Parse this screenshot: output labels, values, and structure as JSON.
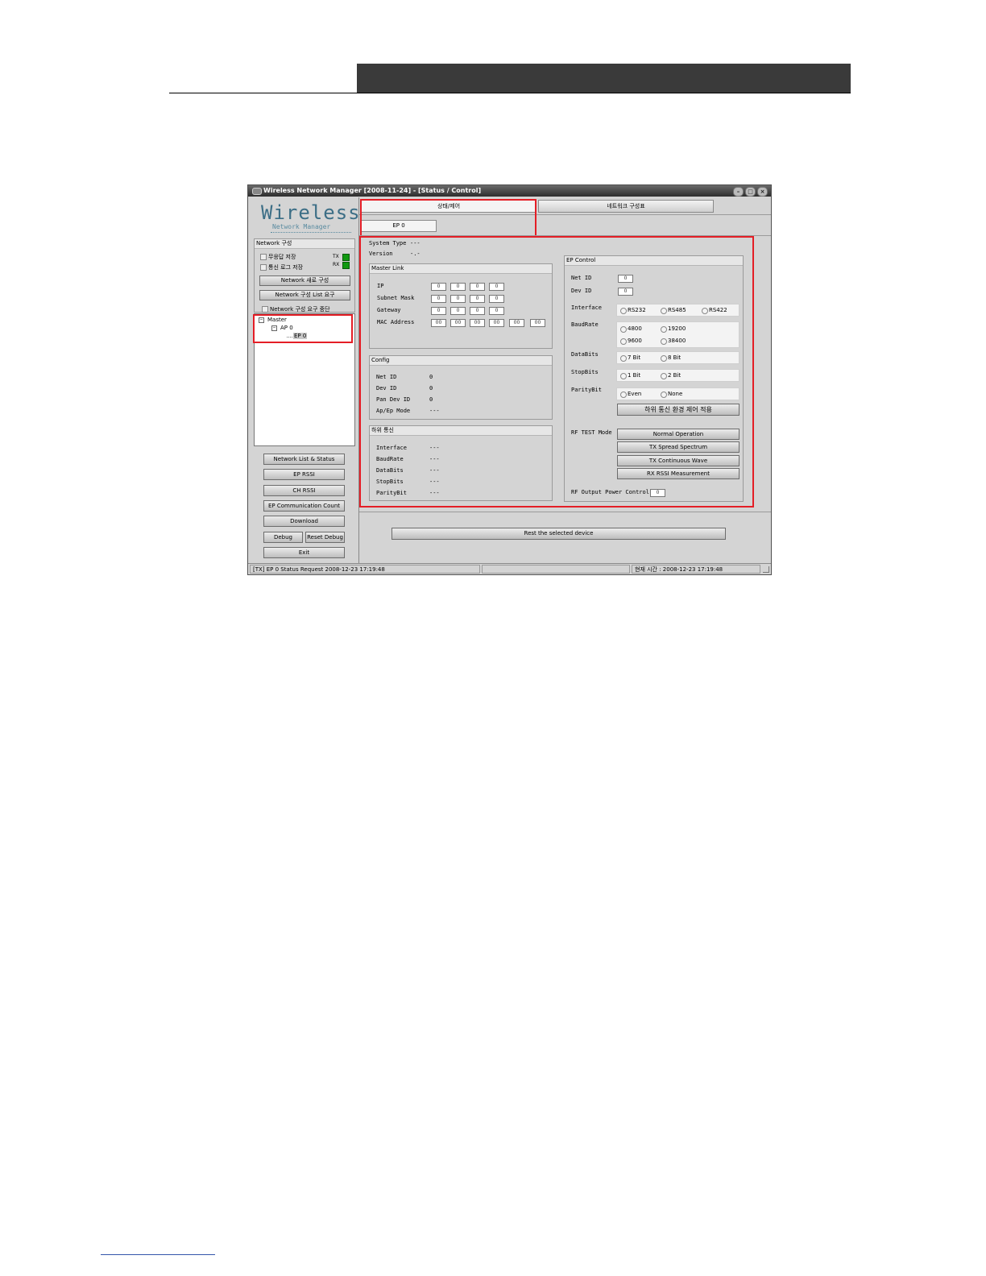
{
  "window": {
    "title": "Wireless Network Manager [2008-11-24] - [Status / Control]",
    "min": "–",
    "max": "□",
    "close": "×"
  },
  "logo": {
    "title": "Wireless",
    "subtitle": "Network Manager"
  },
  "network_group": {
    "title": "Network 구성",
    "chk_no_response_save": "무응답 저장",
    "chk_comm_log_save": "통신 로그 저장",
    "tx_label": "TX",
    "rx_label": "RX",
    "btn_new_config": "Network 새로 구성",
    "btn_config_list_request": "Network 구성 List 요구",
    "chk_config_request_stop": "Network 구성 요구 중단"
  },
  "tree": {
    "master": "Master",
    "ap": "AP 0",
    "ep": "EP 0"
  },
  "left_buttons": {
    "network_list_status": "Network List & Status",
    "ep_rssi": "EP RSSI",
    "ch_rssi": "CH RSSI",
    "ep_comm_count": "EP Communication Count",
    "download": "Download",
    "debug": "Debug",
    "reset_debug": "Reset Debug",
    "exit": "Exit"
  },
  "tabs": {
    "status_control": "상태/제어",
    "network_config": "네트워크 구성표",
    "ep0": "EP 0"
  },
  "system": {
    "type_label": "System Type",
    "type_value": "---",
    "version_label": "Version",
    "version_value": "-.-"
  },
  "master_link": {
    "title": "Master Link",
    "ip_label": "IP",
    "subnet_label": "Subnet Mask",
    "gateway_label": "Gateway",
    "mac_label": "MAC Address",
    "ip": [
      "0",
      "0",
      "0",
      "0"
    ],
    "subnet": [
      "0",
      "0",
      "0",
      "0"
    ],
    "gateway": [
      "0",
      "0",
      "0",
      "0"
    ],
    "mac": [
      "00",
      "00",
      "00",
      "00",
      "00",
      "00"
    ]
  },
  "config": {
    "title": "Config",
    "net_id_label": "Net ID",
    "net_id": "0",
    "dev_id_label": "Dev ID",
    "dev_id": "0",
    "pan_dev_id_label": "Pan Dev ID",
    "pan_dev_id": "0",
    "mode_label": "Ap/Ep Mode",
    "mode": "---"
  },
  "lower_comm": {
    "title": "하위 통신",
    "interface_label": "Interface",
    "interface": "---",
    "baudrate_label": "BaudRate",
    "baudrate": "---",
    "databits_label": "DataBits",
    "databits": "---",
    "stopbits_label": "StopBits",
    "stopbits": "---",
    "paritybit_label": "ParityBit",
    "paritybit": "---"
  },
  "ep_control": {
    "title": "EP Control",
    "net_id_label": "Net ID",
    "net_id": "0",
    "dev_id_label": "Dev ID",
    "dev_id": "0",
    "interface_label": "Interface",
    "interface_options": [
      "RS232",
      "RS485",
      "RS422"
    ],
    "baudrate_label": "BaudRate",
    "baud_options": [
      "4800",
      "19200",
      "9600",
      "38400"
    ],
    "databits_label": "DataBits",
    "databits_options": [
      "7 Bit",
      "8 Bit"
    ],
    "stopbits_label": "StopBits",
    "stopbits_options": [
      "1 Bit",
      "2 Bit"
    ],
    "paritybit_label": "ParityBit",
    "parity_options": [
      "Even",
      "None"
    ],
    "apply_button": "하위 통신 환경 제어 적용",
    "rf_test_label": "RF TEST Mode",
    "rf_buttons": [
      "Normal Operation",
      "TX Spread Spectrum",
      "TX Continuous Wave",
      "RX RSSI Measurement"
    ],
    "rf_power_label": "RF Output Power Control",
    "rf_power_value": "0"
  },
  "reset_button": "Rest the selected device",
  "statusbar": {
    "left": "[TX] EP 0  Status Request 2008-12-23 17:19:48",
    "right": "현재 시간 : 2008-12-23 17:19:48"
  },
  "colors": {
    "highlight_red": "#e41e26",
    "led_green": "#119911",
    "logo_blue": "#3c6e86"
  }
}
